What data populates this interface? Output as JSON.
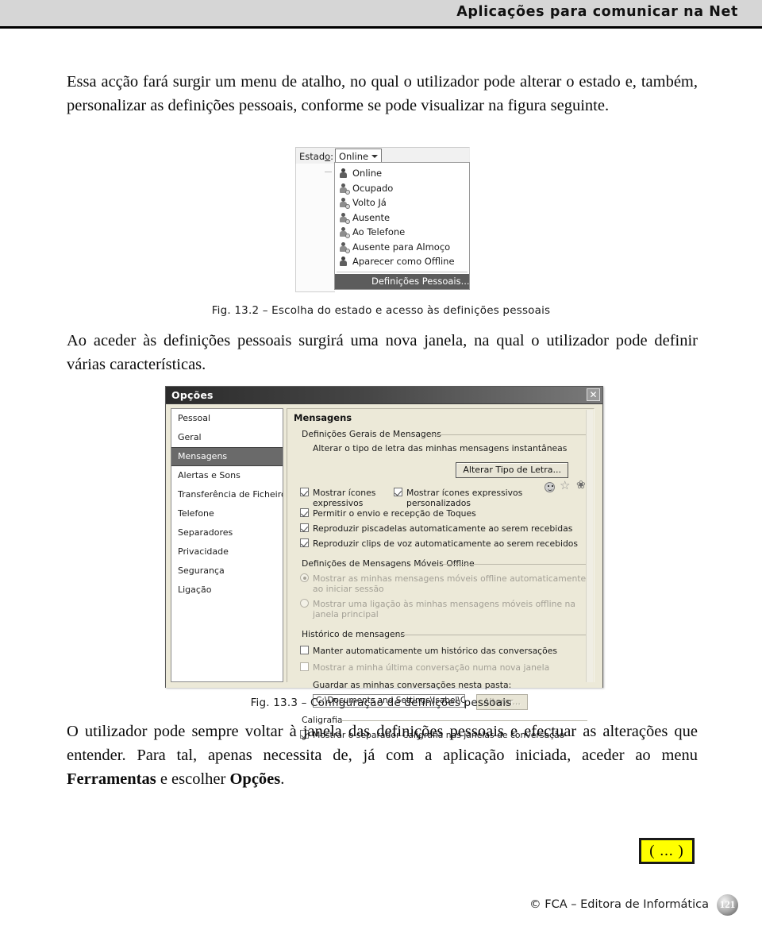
{
  "header": {
    "title": "Aplicações para comunicar na Net"
  },
  "paragraphs": {
    "p1": "Essa acção fará surgir um menu de atalho, no qual o utilizador pode alterar o estado e, também, personalizar as definições pessoais, conforme se pode visualizar na figura seguinte.",
    "p2": "Ao aceder às definições pessoais surgirá uma nova janela, na qual o utilizador pode definir várias características.",
    "p3_part1": "O utilizador pode sempre voltar à janela das definições pessoais e efectuar as alterações que entender. Para tal, apenas necessita de, já com a aplicação iniciada, aceder ao menu ",
    "p3_bold1": "Ferramentas",
    "p3_part2": " e escolher ",
    "p3_bold2": "Opções",
    "p3_part3": "."
  },
  "captions": {
    "fig_13_2": "Fig. 13.2 – Escolha do estado e acesso às definições pessoais",
    "fig_13_3": "Fig. 13.3 – Configuração de definições pessoais"
  },
  "status_figure": {
    "label": "Estado:",
    "label_underlined_char": "o",
    "selected": "Online",
    "items": [
      "Online",
      "Ocupado",
      "Volto Já",
      "Ausente",
      "Ao Telefone",
      "Ausente para Almoço",
      "Aparecer como Offline"
    ],
    "personal_settings": "Definições Pessoais..."
  },
  "options_dialog": {
    "title": "Opções",
    "close_label": "✕",
    "sidebar": [
      {
        "label": "Pessoal",
        "selected": false
      },
      {
        "label": "Geral",
        "selected": false
      },
      {
        "label": "Mensagens",
        "selected": true
      },
      {
        "label": "Alertas e Sons",
        "selected": false
      },
      {
        "label": "Transferência de Ficheiros",
        "selected": false
      },
      {
        "label": "Telefone",
        "selected": false
      },
      {
        "label": "Separadores",
        "selected": false
      },
      {
        "label": "Privacidade",
        "selected": false
      },
      {
        "label": "Segurança",
        "selected": false
      },
      {
        "label": "Ligação",
        "selected": false
      }
    ],
    "pane_title": "Mensagens",
    "group_general": {
      "legend": "Definições Gerais de Mensagens",
      "description": "Alterar o tipo de letra das minhas mensagens instantâneas",
      "change_font_button": "Alterar Tipo de Letra...",
      "checkbox_show_emoticons": "Mostrar ícones expressivos",
      "checkbox_show_custom_emoticons": "Mostrar ícones expressivos personalizados",
      "checkbox_nudges": "Permitir o envio e recepção de Toques",
      "checkbox_winks": "Reproduzir piscadelas automaticamente ao serem recebidas",
      "checkbox_voice_clips": "Reproduzir clips de voz automaticamente ao serem recebidos",
      "emoticon_icons": [
        "smiley-icon",
        "star-icon",
        "flower-icon"
      ]
    },
    "group_offline": {
      "legend": "Definições de Mensagens Móveis Offline",
      "radio_show_offline": "Mostrar as minhas mensagens móveis offline automaticamente ao iniciar sessão",
      "radio_show_link": "Mostrar uma ligação às minhas mensagens móveis offline na janela principal"
    },
    "group_history": {
      "legend": "Histórico de mensagens",
      "checkbox_keep_history": "Manter automaticamente um histórico das conversações",
      "checkbox_show_last": "Mostrar a minha última conversação numa nova janela",
      "folder_label": "Guardar as minhas conversações nesta pasta:",
      "folder_path": "C:\\Documents and Settings\\Isabel\\Os meus d",
      "change_button": "Alterar..."
    },
    "group_handwriting": {
      "legend": "Caligrafia",
      "checkbox_show_tab": "Mostrar o separador Caligrafia nas janelas de conversação"
    }
  },
  "marker": {
    "text": "( ... )"
  },
  "footer": {
    "copyright": "© FCA – Editora de Informática",
    "page_number": "121"
  }
}
